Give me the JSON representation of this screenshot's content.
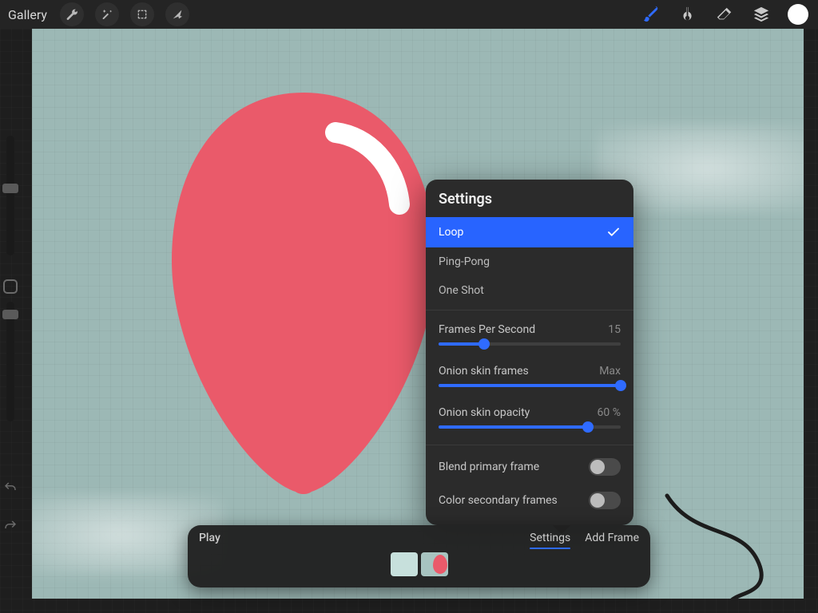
{
  "topbar": {
    "gallery": "Gallery"
  },
  "popover": {
    "title": "Settings",
    "options": {
      "loop": "Loop",
      "pingpong": "Ping-Pong",
      "oneshot": "One Shot"
    },
    "fps": {
      "label": "Frames Per Second",
      "value": "15",
      "percent": 25
    },
    "onion_frames": {
      "label": "Onion skin frames",
      "value": "Max",
      "percent": 100
    },
    "onion_opacity": {
      "label": "Onion skin opacity",
      "value": "60 %",
      "percent": 82
    },
    "blend": {
      "label": "Blend primary frame"
    },
    "color_secondary": {
      "label": "Color secondary frames"
    }
  },
  "timeline": {
    "play": "Play",
    "settings": "Settings",
    "add_frame": "Add Frame"
  },
  "colors": {
    "accent": "#2f6bff",
    "balloon": "#ea5a6a",
    "canvas": "#9cb8b5"
  }
}
